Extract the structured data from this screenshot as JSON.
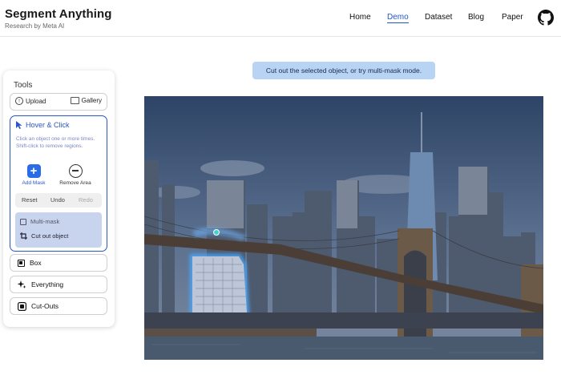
{
  "header": {
    "title": "Segment Anything",
    "subtitle": "Research by Meta AI",
    "nav": [
      {
        "label": "Home",
        "active": false
      },
      {
        "label": "Demo",
        "active": true
      },
      {
        "label": "Dataset",
        "active": false
      },
      {
        "label": "Blog",
        "active": false
      },
      {
        "label": "Paper",
        "active": false
      }
    ],
    "github_icon": "github-icon"
  },
  "tools": {
    "heading": "Tools",
    "upload_label": "Upload",
    "gallery_label": "Gallery",
    "hover_click": {
      "title": "Hover & Click",
      "description": "Click an object one or more times. Shift-click to remove regions.",
      "add_mask_label": "Add Mask",
      "remove_area_label": "Remove Area",
      "reset_label": "Reset",
      "undo_label": "Undo",
      "redo_label": "Redo",
      "multi_mask_label": "Multi-mask",
      "cut_out_label": "Cut out object"
    },
    "box_label": "Box",
    "everything_label": "Everything",
    "cutouts_label": "Cut-Outs"
  },
  "hint": "Cut out the selected object, or try multi-mask mode.",
  "colors": {
    "accent": "#2a55c8",
    "add_mask": "#2a6be8",
    "hint_bg": "#b8d4f5",
    "mask_glow": "#4aa8ff"
  }
}
